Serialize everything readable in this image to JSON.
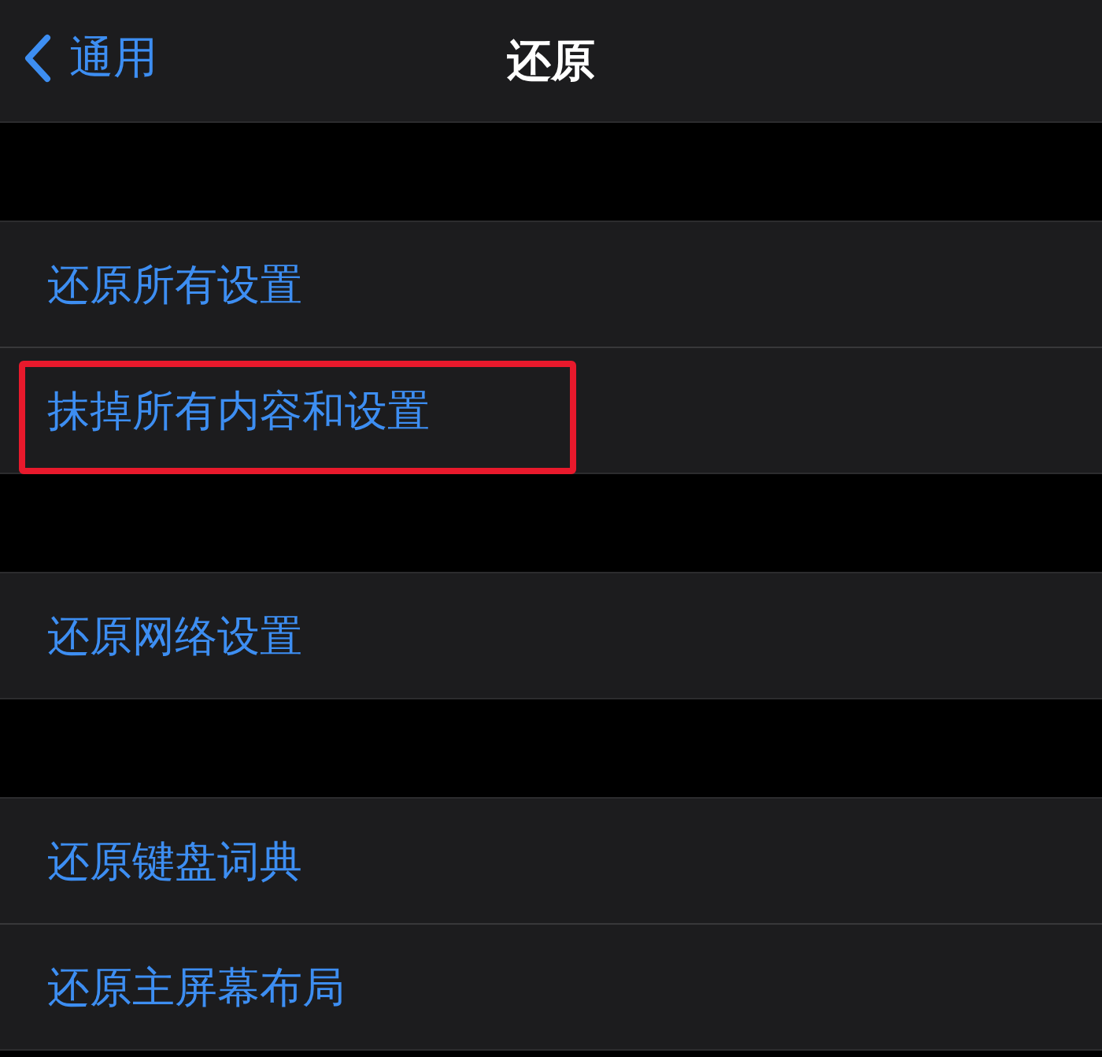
{
  "nav_bar": {
    "back_label": "通用",
    "title": "还原"
  },
  "groups": [
    {
      "rows": [
        {
          "label": "还原所有设置",
          "highlighted": false
        },
        {
          "label": "抹掉所有内容和设置",
          "highlighted": true
        }
      ]
    },
    {
      "rows": [
        {
          "label": "还原网络设置",
          "highlighted": false
        }
      ]
    },
    {
      "rows": [
        {
          "label": "还原键盘词典",
          "highlighted": false
        },
        {
          "label": "还原主屏幕布局",
          "highlighted": false
        }
      ]
    }
  ]
}
